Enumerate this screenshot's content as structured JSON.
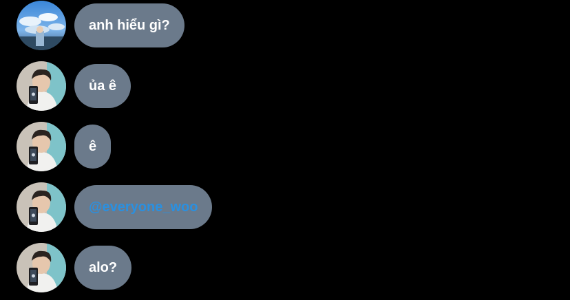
{
  "messages": [
    {
      "avatar": "sky-photo-avatar",
      "text": "anh hiểu gì?",
      "mention": false
    },
    {
      "avatar": "selfie-avatar",
      "text": "ủa ê",
      "mention": false
    },
    {
      "avatar": "selfie-avatar",
      "text": "ê",
      "mention": false
    },
    {
      "avatar": "selfie-avatar",
      "text": "@everyone_woo",
      "mention": true
    },
    {
      "avatar": "selfie-avatar",
      "text": "alo?",
      "mention": false
    }
  ],
  "colors": {
    "background": "#000000",
    "bubble": "#6b7a8b",
    "text": "#ffffff",
    "mention": "#2a90e0"
  }
}
